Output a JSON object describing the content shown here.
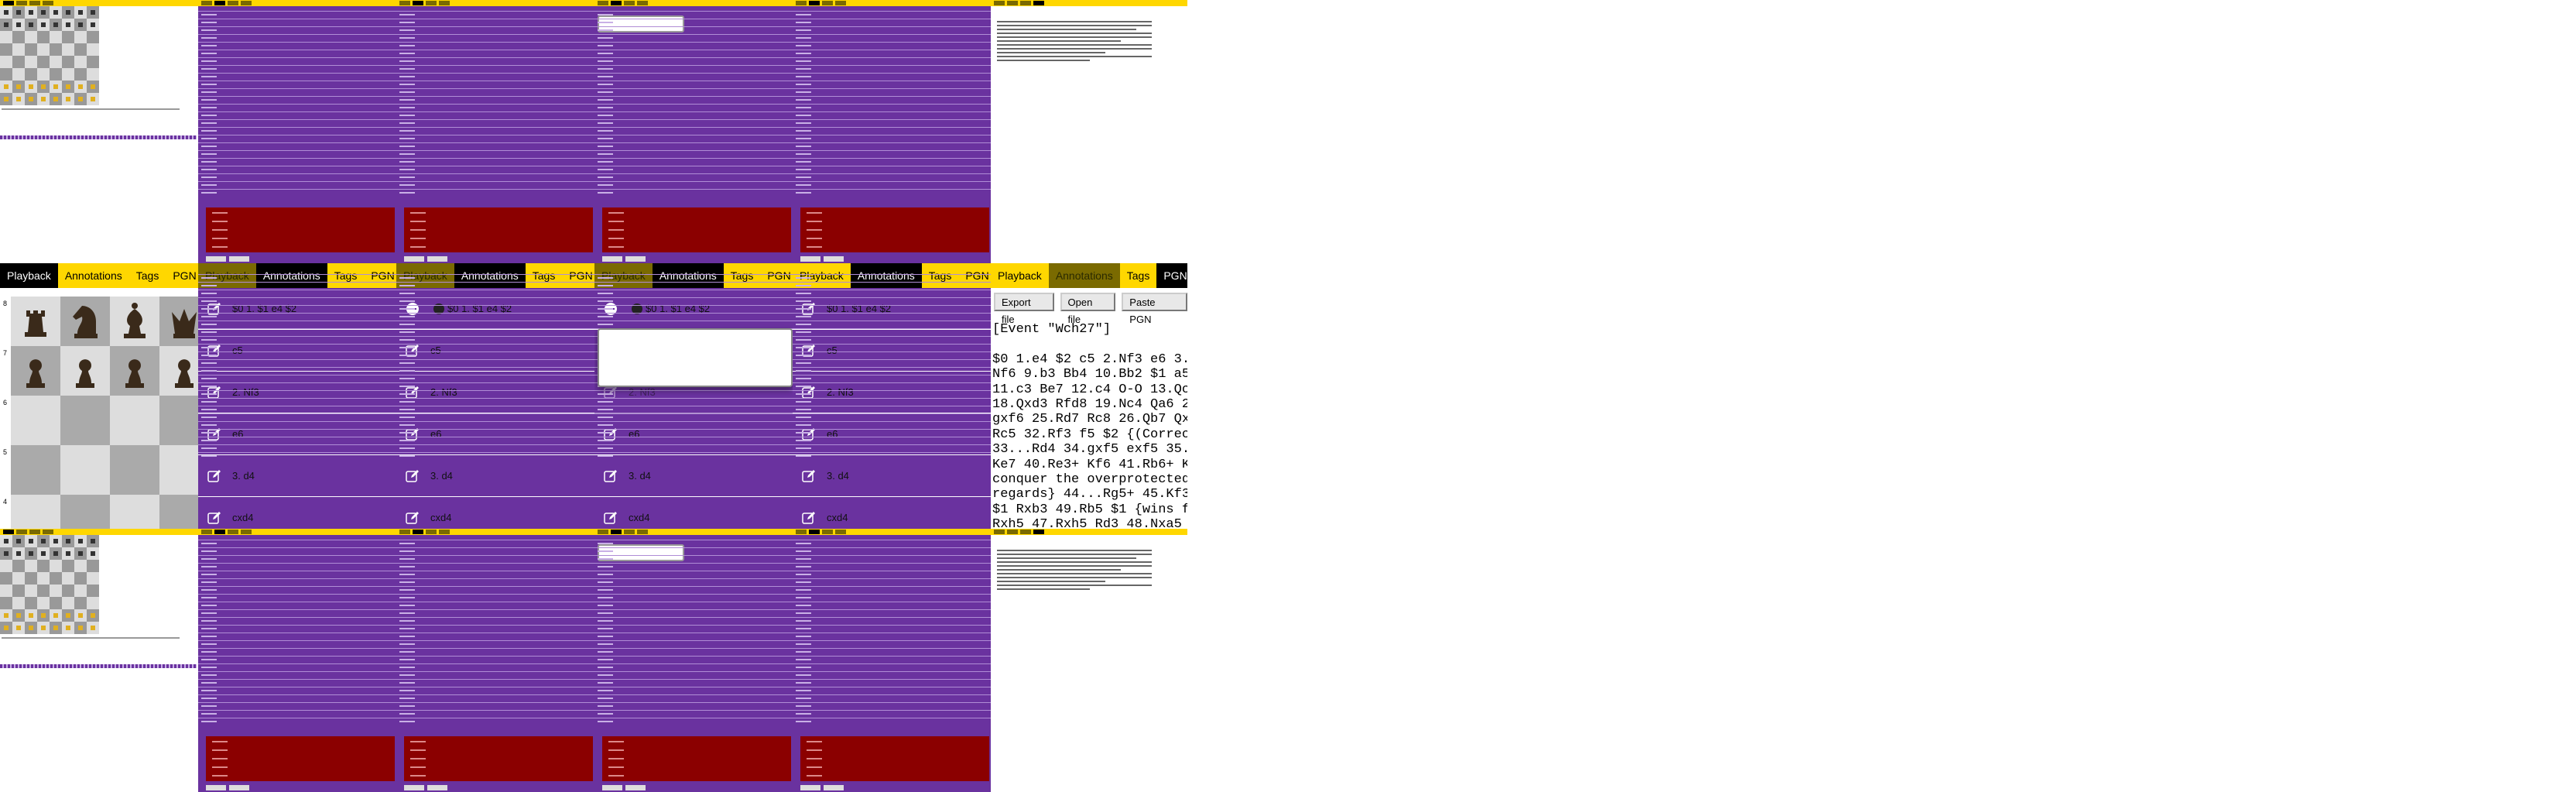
{
  "tabs": [
    "Playback",
    "Annotations",
    "Tags",
    "PGN"
  ],
  "notation": {
    "row1": "$0 1. $1 e4 $2",
    "row1_short": "$1 e4 $2",
    "row2": "c5",
    "row3": "2. Nf3",
    "row4": "e6",
    "row5": "3. d4",
    "row6": "cxd4"
  },
  "board": {
    "ranks": [
      "8",
      "7",
      "6",
      "5",
      "4"
    ]
  },
  "pgn": {
    "export_label": "Export file",
    "open_label": "Open file",
    "paste_label": "Paste PGN",
    "text": "[Event \"Wch27\"]\n\n$0 1.e4 $2 c5 2.Nf3 e6 3.\nNf6 9.b3 Bb4 10.Bb2 $1 a5\n11.c3 Be7 12.c4 O-O 13.Qc\n18.Qxd3 Rfd8 19.Nc4 Qa6 2\ngxf6 25.Rd7 Rc8 26.Qb7 Qx\nRc5 32.Rf3 f5 $2 {(Correc\n33...Rd4 34.gxf5 exf5 35.\nKe7 40.Re3+ Kf6 41.Rb6+ K\nconquer the overprotected\nregards} 44...Rg5+ 45.Kf3\n$1 Rxb3 49.Rb5 $1 {wins f\nRxh5 47.Rxh5 Rd3 48.Nxa5"
  },
  "colors": {
    "yellow": "#ffd700",
    "purple": "#6a329f",
    "red": "#8b0000",
    "black": "#000000"
  }
}
